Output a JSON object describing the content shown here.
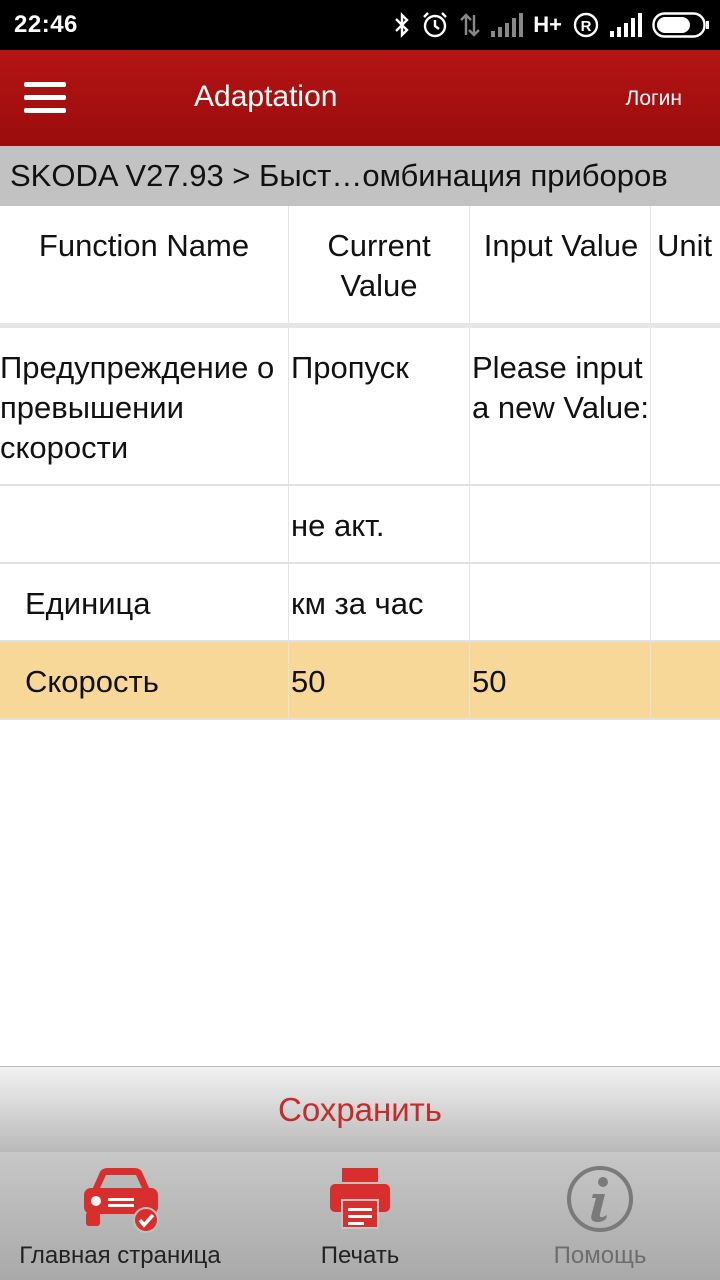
{
  "status_bar": {
    "time": "22:46",
    "network_label": "H+",
    "icons": [
      "bluetooth-icon",
      "alarm-icon",
      "data-arrows-icon",
      "signal-icon",
      "roaming-icon",
      "signal-icon",
      "battery-icon"
    ]
  },
  "app_bar": {
    "title": "Adaptation",
    "login_label": "Логин",
    "menu_icon": "hamburger-menu-icon",
    "background_color": "#a81010"
  },
  "breadcrumb": "SKODA V27.93 > Быст…омбинация приборов",
  "table": {
    "columns": [
      "Function Name",
      "Current Value",
      "Input Value",
      "Unit"
    ],
    "rows": [
      {
        "function_name": "Предупреждение о превышении скорости",
        "current_value": "Пропуск",
        "input_value": "Please input a new Value:",
        "unit": ""
      },
      {
        "function_name": "",
        "current_value": "не акт.",
        "input_value": "",
        "unit": ""
      },
      {
        "function_name": "Единица",
        "current_value": "км за час",
        "input_value": "",
        "unit": ""
      },
      {
        "function_name": "Скорость",
        "current_value": "50",
        "input_value": "50",
        "unit": "",
        "selected": true
      }
    ],
    "selected_row_color": "#f8d899"
  },
  "save_button": {
    "label": "Сохранить",
    "color": "#c62b2b"
  },
  "bottom_nav": [
    {
      "label": "Главная страница",
      "icon": "car-check-icon"
    },
    {
      "label": "Печать",
      "icon": "printer-icon"
    },
    {
      "label": "Помощь",
      "icon": "info-icon"
    }
  ]
}
